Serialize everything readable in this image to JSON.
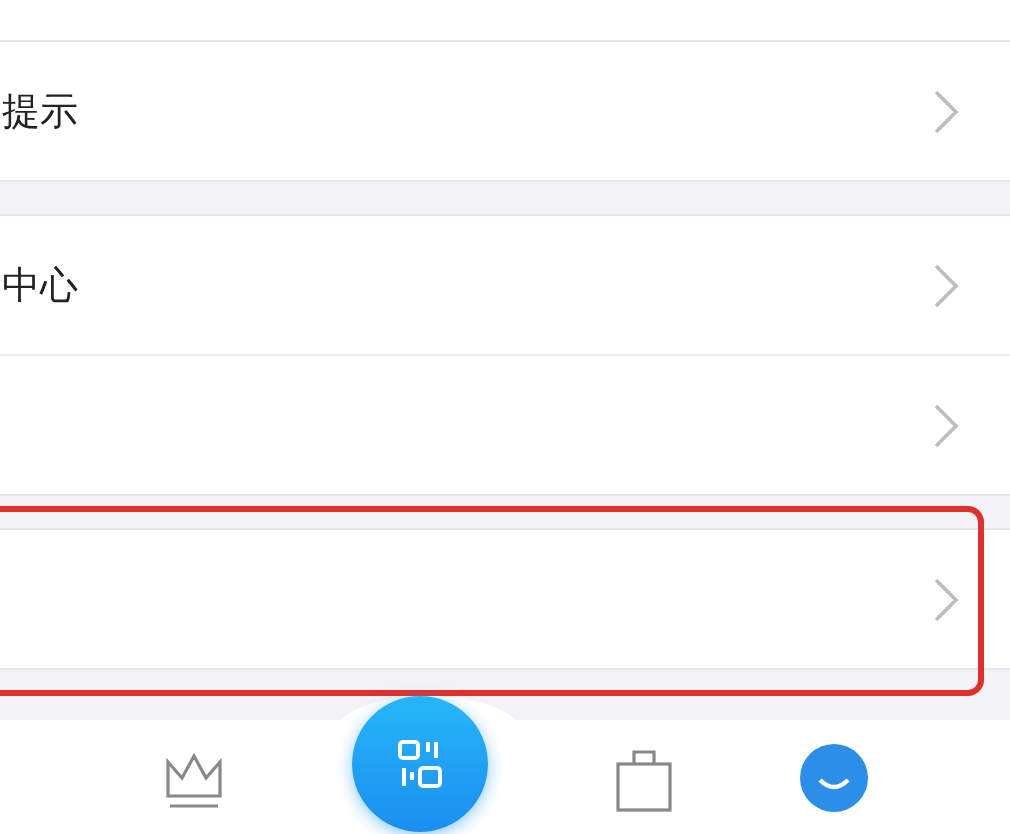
{
  "groups": [
    {
      "rows": [
        {
          "label": "提示",
          "highlighted": false
        }
      ]
    },
    {
      "rows": [
        {
          "label": "中心",
          "highlighted": false
        },
        {
          "label": "",
          "highlighted": false
        }
      ]
    },
    {
      "rows": [
        {
          "label": "",
          "highlighted": true
        }
      ]
    }
  ],
  "tab_bar": [
    {
      "kind": "crown",
      "selected": false
    },
    {
      "kind": "scan",
      "selected": false
    },
    {
      "kind": "bag",
      "selected": false
    },
    {
      "kind": "face",
      "selected": true
    }
  ]
}
